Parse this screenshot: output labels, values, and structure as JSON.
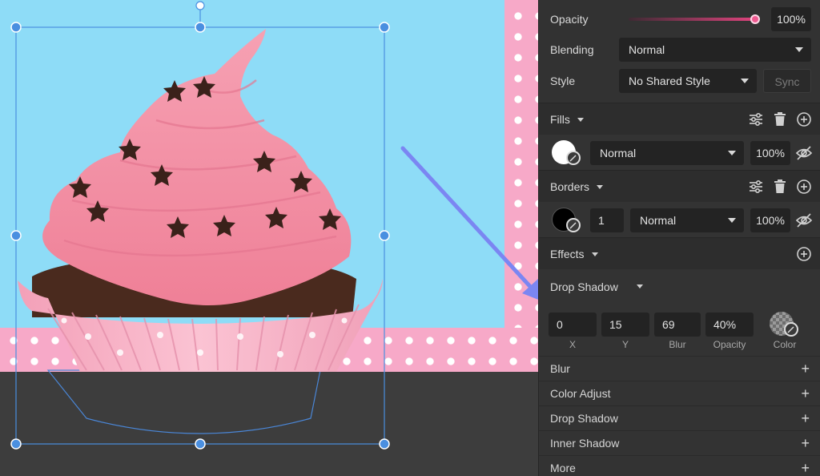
{
  "inspector": {
    "opacity": {
      "label": "Opacity",
      "value": "100%",
      "level": 1.0
    },
    "blending": {
      "label": "Blending",
      "value": "Normal"
    },
    "style": {
      "label": "Style",
      "value": "No Shared Style",
      "sync_label": "Sync"
    },
    "fills": {
      "title": "Fills",
      "items": [
        {
          "color": "#ffffff",
          "blend": "Normal",
          "opacity": "100%"
        }
      ]
    },
    "borders": {
      "title": "Borders",
      "items": [
        {
          "color": "#000000",
          "width": "1",
          "blend": "Normal",
          "opacity": "100%"
        }
      ]
    },
    "effects": {
      "title": "Effects",
      "drop_shadow": {
        "title": "Drop Shadow",
        "x": "0",
        "y": "15",
        "blur": "69",
        "opacity": "40%",
        "captions": {
          "x": "X",
          "y": "Y",
          "blur": "Blur",
          "opacity": "Opacity",
          "color": "Color"
        }
      },
      "list": [
        "Blur",
        "Color Adjust",
        "Drop Shadow",
        "Inner Shadow",
        "More"
      ]
    }
  },
  "colors": {
    "canvas_bg": "#8edcf7",
    "pink_pattern": "#f7a9c8",
    "frosting": "#f58fa5",
    "selection": "#4a8fe0",
    "arrow": "#7b86f2",
    "opacity_slider": "#e2447f"
  },
  "icons": [
    "settings-sliders-icon",
    "trash-icon",
    "add-circle-icon",
    "eye-off-icon",
    "eyedropper-icon",
    "chevron-down-icon",
    "plus-icon"
  ]
}
